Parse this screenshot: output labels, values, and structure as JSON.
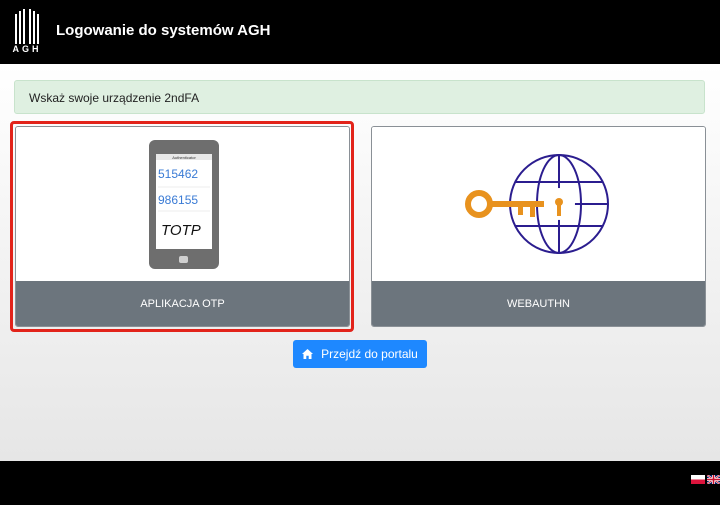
{
  "header": {
    "logo_text": "AGH",
    "title": "Logowanie do systemów AGH"
  },
  "alert": {
    "text": "Wskaż swoje urządzenie 2ndFA"
  },
  "options": [
    {
      "label": "APLIKACJA OTP",
      "selected": true,
      "icon": "phone-totp-icon",
      "phone": {
        "app_title": "Authenticator",
        "code1": "515462",
        "code2": "986155",
        "caption": "TOTP"
      }
    },
    {
      "label": "WEBAUTHN",
      "selected": false,
      "icon": "globe-key-icon"
    }
  ],
  "portal_button": {
    "label": "Przejdź do portalu",
    "icon": "home-icon"
  },
  "languages": [
    {
      "icon": "flag-pl-icon"
    },
    {
      "icon": "flag-uk-icon"
    }
  ],
  "colors": {
    "header_bg": "#000000",
    "alert_bg": "#dff0e1",
    "card_label_bg": "#6c757d",
    "selected_outline": "#e2231a",
    "primary_button": "#1e88ff",
    "key_orange": "#e8921e",
    "globe_purple": "#2b1d8f"
  }
}
